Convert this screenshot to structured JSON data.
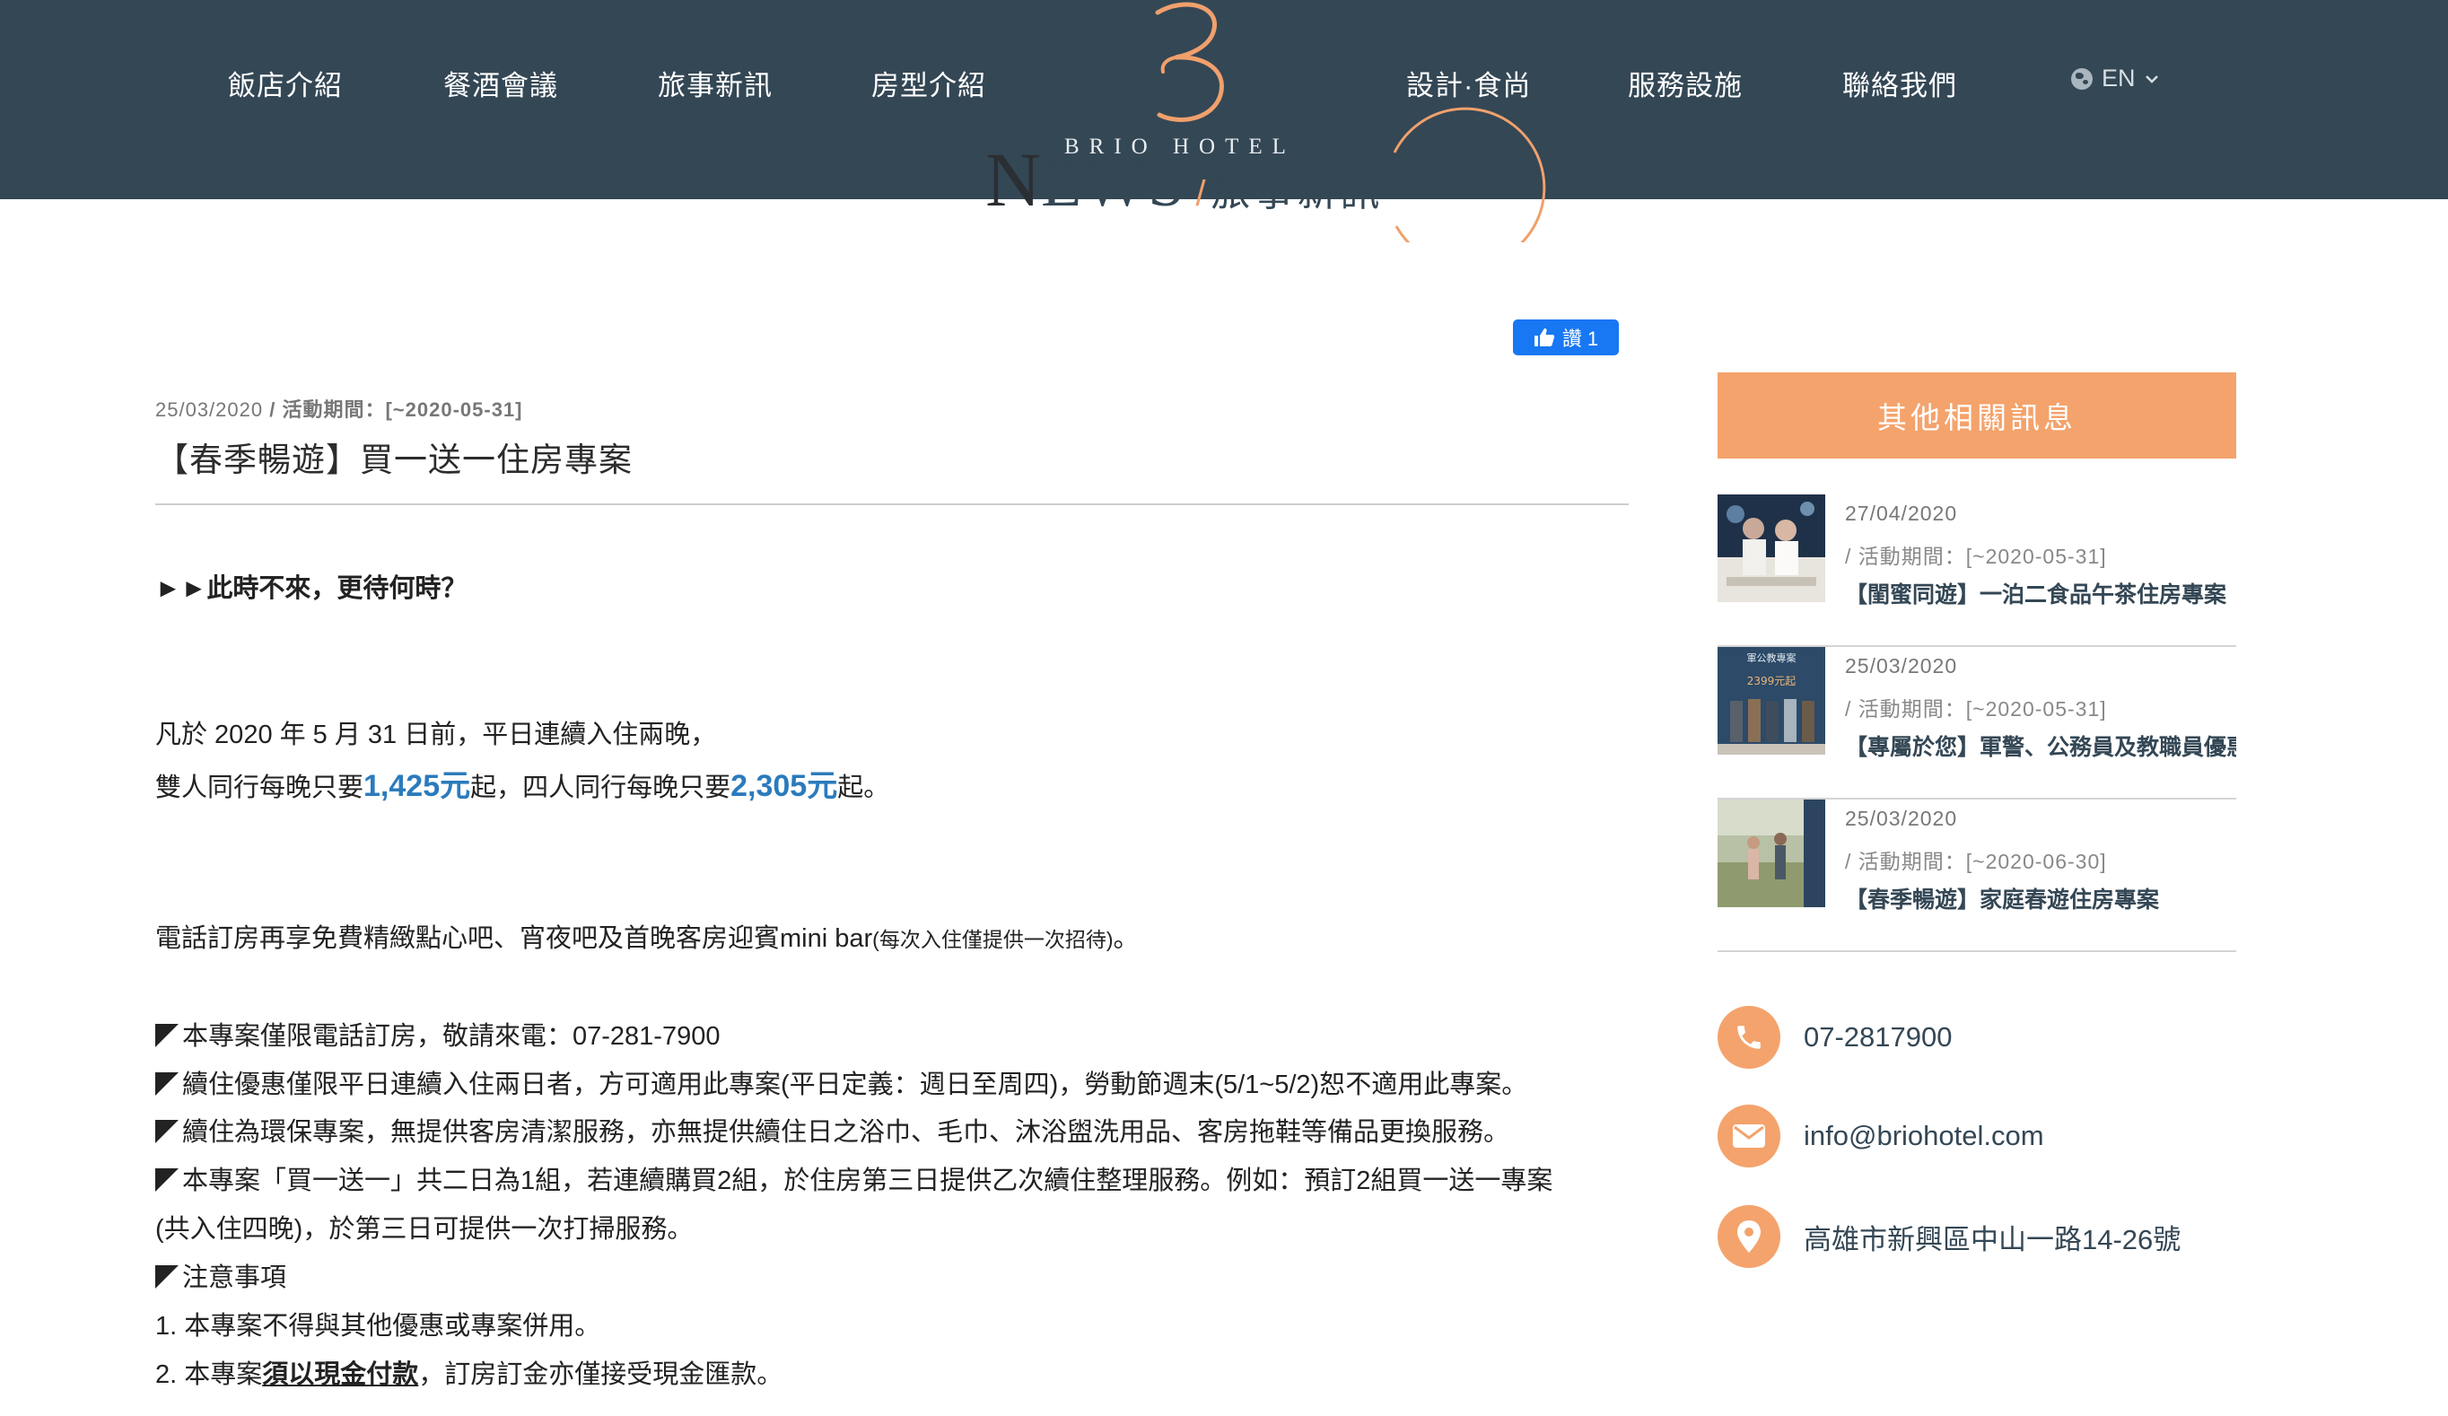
{
  "nav": {
    "left": [
      "飯店介紹",
      "餐酒會議",
      "旅事新訊",
      "房型介紹"
    ],
    "right": [
      "設計·食尚",
      "服務設施",
      "聯絡我們"
    ],
    "lang": "EN"
  },
  "brand": {
    "name": "BRIO HOTEL"
  },
  "heading": {
    "n": "N",
    "ews": "EWS",
    "sep": "/",
    "zh": "旅事新訊"
  },
  "fb": {
    "label": "讚 1"
  },
  "article": {
    "date": "25/03/2020",
    "period": "/ 活動期間：[~2020-05-31]",
    "title": "【春季暢遊】買一送一住房專案",
    "tagline": "►►此時不來，更待何時？",
    "line1": "凡於 2020 年 5 月 31 日前，平日連續入住兩晚，",
    "line2a": "雙人同行每晚只要",
    "price1": "1,425元",
    "line2b": "起，四人同行每晚只要",
    "price2": "2,305元",
    "line2c": "起。",
    "line3a": "電話訂房再享免費精緻點心吧、宵夜吧及首晚客房迎賓mini bar",
    "line3b": "(每次入住僅提供一次招待)",
    "line3c": "。",
    "bullet1": "本專案僅限電話訂房，敬請來電：07-281-7900",
    "bullet2": "續住優惠僅限平日連續入住兩日者，方可適用此專案(平日定義：週日至周四)，勞動節週末(5/1~5/2)恕不適用此專案。",
    "bullet3": "續住為環保專案，無提供客房清潔服務，亦無提供續住日之浴巾、毛巾、沐浴盥洗用品、客房拖鞋等備品更換服務。",
    "bullet4a": "本專案「買一送一」共二日為1組，若連續購買2組，於住房第三日提供乙次續住整理服務。例如：預訂2組買一送一專案",
    "bullet4b": "(共入住四晚)，於第三日可提供一次打掃服務。",
    "bullet5": "注意事項",
    "note1": "1. 本專案不得與其他優惠或專案併用。",
    "note2a": "2. 本專案",
    "note2b": "須以現金付款",
    "note2c": "，訂房訂金亦僅接受現金匯款。"
  },
  "sidebar": {
    "heading": "其他相關訊息",
    "items": [
      {
        "date": "27/04/2020",
        "period": "/ 活動期間：[~2020-05-31]",
        "title": "【閨蜜同遊】一泊二食品午茶住房專案"
      },
      {
        "date": "25/03/2020",
        "period": "/ 活動期間：[~2020-05-31]",
        "title": "【專屬於您】軍警、公務員及教職員優惠"
      },
      {
        "date": "25/03/2020",
        "period": "/ 活動期間：[~2020-06-30]",
        "title": "【春季暢遊】家庭春遊住房專案"
      }
    ],
    "thumb2_text1": "軍公教專案",
    "thumb2_text2": "2399元起",
    "phone": "07-2817900",
    "email": "info@briohotel.com",
    "address": "高雄市新興區中山一路14-26號"
  },
  "colors": {
    "header": "#344755",
    "accent": "#f4a36c",
    "price": "#2b7bbd"
  }
}
